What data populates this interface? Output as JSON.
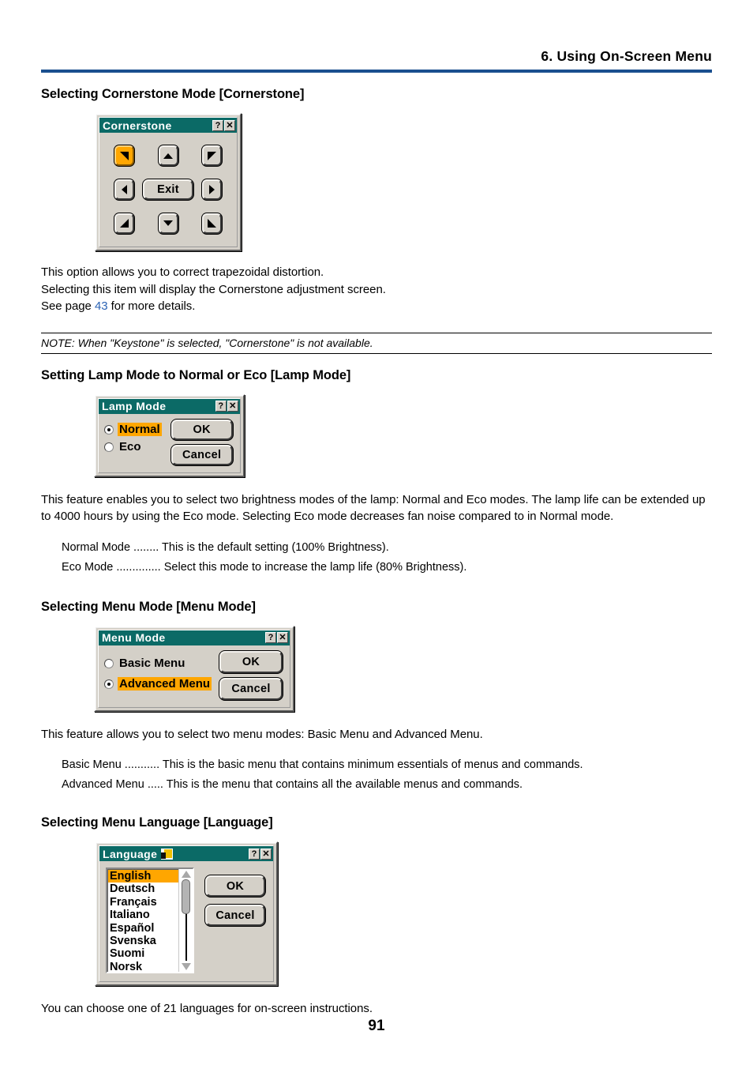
{
  "header": {
    "chapter_title": "6. Using On-Screen Menu"
  },
  "sections": {
    "cornerstone": {
      "heading": "Selecting Cornerstone Mode [Cornerstone]",
      "dialog": {
        "title": "Cornerstone",
        "help_button": "?",
        "close_button": "✕",
        "exit_label": "Exit",
        "buttons": [
          {
            "name": "down-right",
            "selected": true
          },
          {
            "name": "up",
            "selected": false
          },
          {
            "name": "down-left",
            "selected": false
          },
          {
            "name": "left",
            "selected": false
          },
          {
            "name": "exit",
            "selected": false
          },
          {
            "name": "right",
            "selected": false
          },
          {
            "name": "up-right",
            "selected": false
          },
          {
            "name": "down",
            "selected": false
          },
          {
            "name": "up-left",
            "selected": false
          }
        ]
      },
      "paragraph_line1": "This option allows you to correct trapezoidal distortion.",
      "paragraph_line2": "Selecting this item will display the Cornerstone adjustment screen.",
      "see_page_prefix": "See page ",
      "see_page_number": "43",
      "see_page_suffix": " for more details.",
      "note": "NOTE: When \"Keystone\" is selected, \"Cornerstone\" is not available."
    },
    "lamp_mode": {
      "heading": "Setting Lamp Mode to Normal or Eco [Lamp Mode]",
      "dialog": {
        "title": "Lamp Mode",
        "help_button": "?",
        "close_button": "✕",
        "options": [
          {
            "label": "Normal",
            "selected": true
          },
          {
            "label": "Eco",
            "selected": false
          }
        ],
        "ok_label": "OK",
        "cancel_label": "Cancel"
      },
      "paragraph": "This feature enables you to select two brightness modes of the lamp: Normal and Eco modes. The lamp life can be extended up to 4000 hours by using the Eco mode. Selecting Eco mode decreases fan noise compared to in Normal mode.",
      "definitions": [
        "Normal Mode ........ This is the default setting (100% Brightness).",
        "Eco Mode .............. Select this mode to increase the lamp life (80% Brightness)."
      ]
    },
    "menu_mode": {
      "heading": "Selecting Menu Mode [Menu Mode]",
      "dialog": {
        "title": "Menu Mode",
        "help_button": "?",
        "close_button": "✕",
        "options": [
          {
            "label": "Basic Menu",
            "selected": false
          },
          {
            "label": "Advanced Menu",
            "selected": true
          }
        ],
        "ok_label": "OK",
        "cancel_label": "Cancel"
      },
      "paragraph": "This feature allows you to select two menu modes: Basic Menu and Advanced Menu.",
      "definitions": [
        "Basic Menu ........... This is the basic menu that contains minimum essentials of menus and commands.",
        "Advanced Menu ..... This is the menu that contains all the available menus and commands."
      ]
    },
    "language": {
      "heading": "Selecting Menu Language [Language]",
      "dialog": {
        "title": "Language",
        "help_button": "?",
        "close_button": "✕",
        "languages": [
          {
            "label": "English",
            "selected": true
          },
          {
            "label": "Deutsch",
            "selected": false
          },
          {
            "label": "Français",
            "selected": false
          },
          {
            "label": "Italiano",
            "selected": false
          },
          {
            "label": "Español",
            "selected": false
          },
          {
            "label": "Svenska",
            "selected": false
          },
          {
            "label": "Suomi",
            "selected": false
          },
          {
            "label": "Norsk",
            "selected": false
          }
        ],
        "ok_label": "OK",
        "cancel_label": "Cancel"
      },
      "paragraph": "You can choose one of 21 languages for on-screen instructions."
    }
  },
  "footer": {
    "page_number": "91"
  },
  "colors": {
    "titlebar_teal": "#0b6a66",
    "highlight_orange": "#ffa600",
    "header_rule_blue": "#1a4f8f",
    "dialog_face": "#d4d0c8",
    "link_blue": "#2b63b5"
  }
}
